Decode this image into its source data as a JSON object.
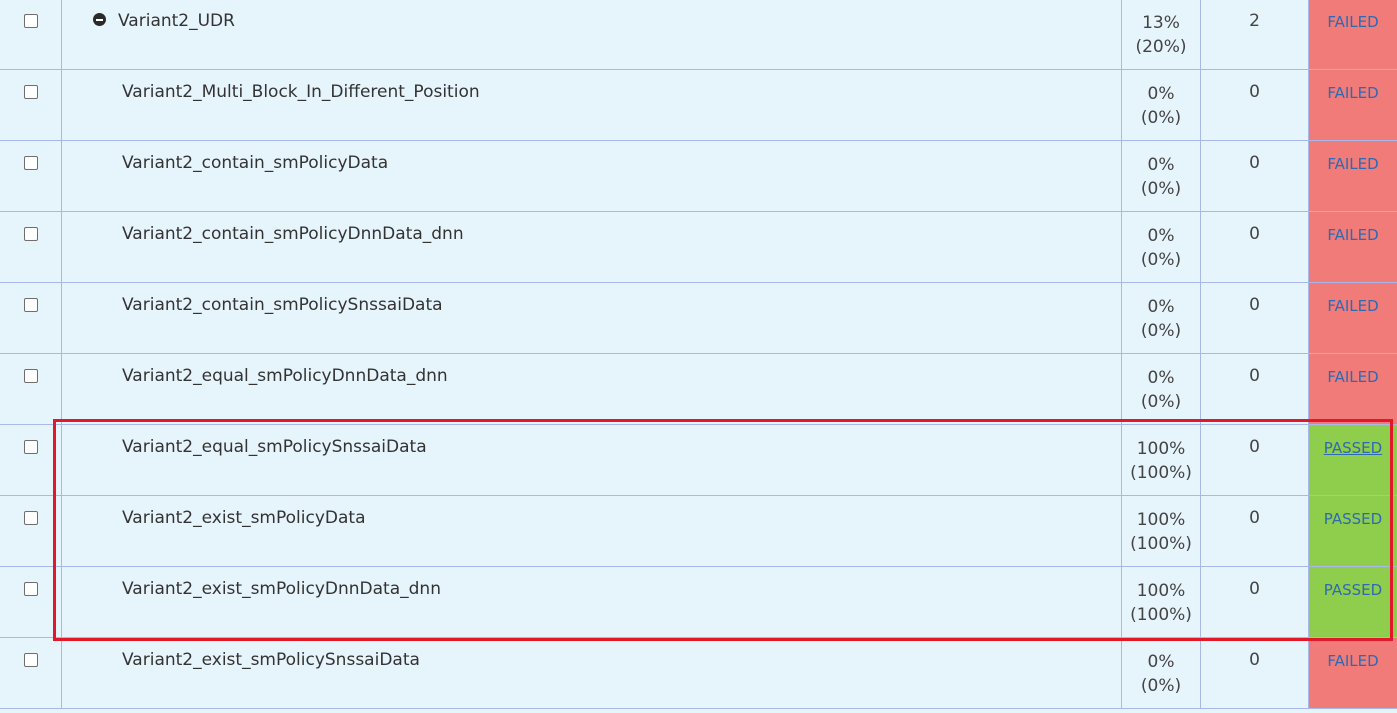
{
  "rows": [
    {
      "name": "Variant2_UDR",
      "pct": "13%",
      "pct_sub": "(20%)",
      "count": "2",
      "status": "FAILED"
    },
    {
      "name": "Variant2_Multi_Block_In_Different_Position",
      "pct": "0%",
      "pct_sub": "(0%)",
      "count": "0",
      "status": "FAILED"
    },
    {
      "name": "Variant2_contain_smPolicyData",
      "pct": "0%",
      "pct_sub": "(0%)",
      "count": "0",
      "status": "FAILED"
    },
    {
      "name": "Variant2_contain_smPolicyDnnData_dnn",
      "pct": "0%",
      "pct_sub": "(0%)",
      "count": "0",
      "status": "FAILED"
    },
    {
      "name": "Variant2_contain_smPolicySnssaiData",
      "pct": "0%",
      "pct_sub": "(0%)",
      "count": "0",
      "status": "FAILED"
    },
    {
      "name": "Variant2_equal_smPolicyDnnData_dnn",
      "pct": "0%",
      "pct_sub": "(0%)",
      "count": "0",
      "status": "FAILED"
    },
    {
      "name": "Variant2_equal_smPolicySnssaiData",
      "pct": "100%",
      "pct_sub": "(100%)",
      "count": "0",
      "status": "PASSED"
    },
    {
      "name": "Variant2_exist_smPolicyData",
      "pct": "100%",
      "pct_sub": "(100%)",
      "count": "0",
      "status": "PASSED"
    },
    {
      "name": "Variant2_exist_smPolicyDnnData_dnn",
      "pct": "100%",
      "pct_sub": "(100%)",
      "count": "0",
      "status": "PASSED"
    },
    {
      "name": "Variant2_exist_smPolicySnssaiData",
      "pct": "0%",
      "pct_sub": "(0%)",
      "count": "0",
      "status": "FAILED"
    }
  ],
  "colors": {
    "row_background": "#e6f4fc",
    "grid_line": "#a8b8e8",
    "failed": "#f07b78",
    "passed": "#8fce4c",
    "link": "#2d6ab3",
    "highlight": "#e0182a"
  },
  "icons": {
    "collapse": "minus-circle-icon"
  }
}
